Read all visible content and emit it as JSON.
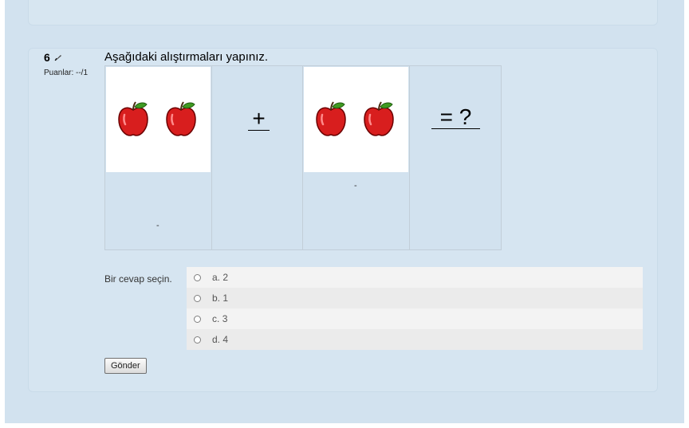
{
  "question": {
    "number": "6",
    "grade": "Puanlar: --/1",
    "text": "Aşağıdaki alıştırmaları yapınız.",
    "operators": {
      "plus": "+",
      "equals": "= ?"
    },
    "dashes": [
      "-",
      "-"
    ],
    "answer_prompt": "Bir cevap seçin.",
    "options": [
      {
        "letter": "a.",
        "value": "2"
      },
      {
        "letter": "b.",
        "value": "1"
      },
      {
        "letter": "c.",
        "value": "3"
      },
      {
        "letter": "d.",
        "value": "4"
      }
    ],
    "submit_label": "Gönder"
  },
  "icons": {
    "flag": "pencil-flag-icon",
    "apple": "apple-icon"
  },
  "colors": {
    "background": "#d2e2ef",
    "apple_red": "#d81e1e",
    "leaf_green": "#3f9a22"
  }
}
